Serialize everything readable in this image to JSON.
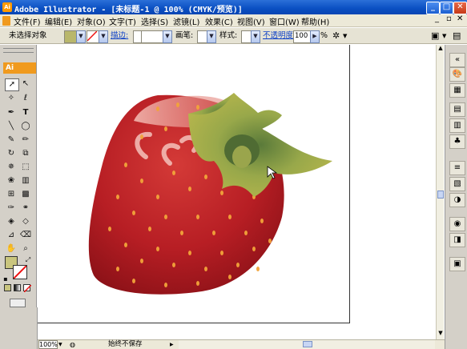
{
  "window": {
    "title": "Adobe Illustrator - [未标题-1 @ 100% (CMYK/预览)]",
    "app_icon": "Ai"
  },
  "window_buttons": {
    "minimize": "_",
    "maximize": "□",
    "close": "✕"
  },
  "menu": [
    "文件(F)",
    "编辑(E)",
    "对象(O)",
    "文字(T)",
    "选择(S)",
    "滤镜(L)",
    "效果(C)",
    "视图(V)",
    "窗口(W)",
    "帮助(H)"
  ],
  "control_bar": {
    "selection_label": "未选择对象",
    "stroke_label": "描边:",
    "brush_label": "画笔:",
    "style_label": "样式:",
    "opacity_label": "不透明度:",
    "opacity_value": "100",
    "opacity_unit": "%"
  },
  "tools_panel": {
    "header": "Ai"
  },
  "status_bar": {
    "zoom": "100%",
    "status": "始终不保存"
  },
  "colors": {
    "title_bar": "#0a4fc2",
    "ai_orange": "#f09a1e",
    "strawberry_red": "#c4262b",
    "leaf_green": "#a9b04a"
  },
  "icons": [
    "selection-tool-icon",
    "direct-selection-tool-icon",
    "magic-wand-icon",
    "lasso-icon",
    "pen-icon",
    "type-icon",
    "line-icon",
    "ellipse-icon",
    "paintbrush-icon",
    "pencil-icon",
    "rotate-icon",
    "scale-icon",
    "warp-icon",
    "free-transform-icon",
    "symbol-sprayer-icon",
    "graph-icon",
    "mesh-icon",
    "gradient-icon",
    "eyedropper-icon",
    "blend-icon",
    "live-paint-icon",
    "live-paint-select-icon",
    "slice-icon",
    "eraser-icon",
    "hand-icon",
    "zoom-icon"
  ]
}
